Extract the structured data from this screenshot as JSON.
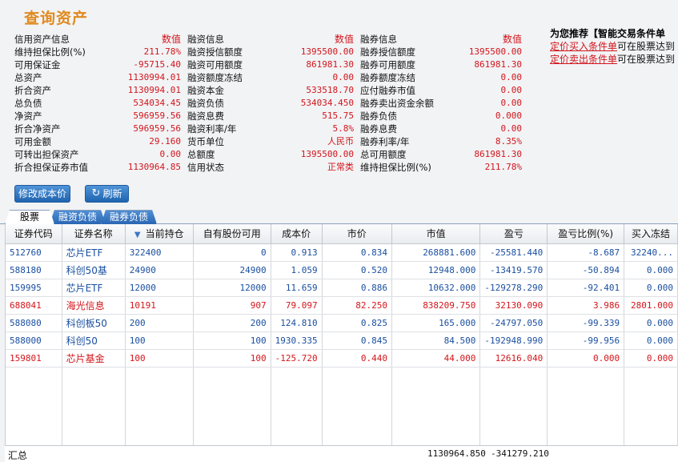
{
  "title": "查询资产",
  "info": {
    "header": [
      {
        "label": "信用资产信息",
        "value": "数值"
      },
      {
        "label": "融资信息",
        "value": "数值"
      },
      {
        "label": "融券信息",
        "value": "数值"
      }
    ],
    "rows": [
      [
        {
          "label": "维持担保比例(%)",
          "value": "211.78%"
        },
        {
          "label": "融资授信额度",
          "value": "1395500.00"
        },
        {
          "label": "融券授信额度",
          "value": "1395500.00"
        }
      ],
      [
        {
          "label": "可用保证金",
          "value": "-95715.40"
        },
        {
          "label": "融资可用额度",
          "value": "861981.30"
        },
        {
          "label": "融券可用额度",
          "value": "861981.30"
        }
      ],
      [
        {
          "label": "总资产",
          "value": "1130994.01"
        },
        {
          "label": "融资额度冻结",
          "value": "0.00"
        },
        {
          "label": "融券额度冻结",
          "value": "0.00"
        }
      ],
      [
        {
          "label": "折合资产",
          "value": "1130994.01"
        },
        {
          "label": "融资本金",
          "value": "533518.70"
        },
        {
          "label": "应付融券市值",
          "value": "0.00"
        }
      ],
      [
        {
          "label": "总负债",
          "value": "534034.45"
        },
        {
          "label": "融资负债",
          "value": "534034.450"
        },
        {
          "label": "融券卖出资金余额",
          "value": "0.00"
        }
      ],
      [
        {
          "label": "净资产",
          "value": "596959.56"
        },
        {
          "label": "融资息费",
          "value": "515.75"
        },
        {
          "label": "融券负债",
          "value": "0.000"
        }
      ],
      [
        {
          "label": "折合净资产",
          "value": "596959.56"
        },
        {
          "label": "融资利率/年",
          "value": "5.8%"
        },
        {
          "label": "融券息费",
          "value": "0.00"
        }
      ],
      [
        {
          "label": "可用金额",
          "value": "29.160"
        },
        {
          "label": "货币单位",
          "value": "人民币"
        },
        {
          "label": "融券利率/年",
          "value": "8.35%"
        }
      ],
      [
        {
          "label": "可转出担保资产",
          "value": "0.00"
        },
        {
          "label": "总额度",
          "value": "1395500.00"
        },
        {
          "label": "总可用额度",
          "value": "861981.30"
        }
      ],
      [
        {
          "label": "折合担保证券市值",
          "value": "1130964.85"
        },
        {
          "label": "信用状态",
          "value": "正常类"
        },
        {
          "label": "维持担保比例(%)",
          "value": "211.78%"
        }
      ]
    ]
  },
  "promo": {
    "title": "为您推荐【智能交易条件单",
    "line1_link": "定价买入条件单",
    "line1_text": "可在股票达到",
    "line2_link": "定价卖出条件单",
    "line2_text": "可在股票达到"
  },
  "buttons": {
    "edit_cost": "修改成本价",
    "refresh": "刷新"
  },
  "tabs": [
    "股票",
    "融资负债",
    "融券负债"
  ],
  "table": {
    "columns": [
      "证券代码",
      "证券名称",
      "当前持仓",
      "自有股份可用",
      "成本价",
      "市价",
      "市值",
      "盈亏",
      "盈亏比例(%)",
      "买入冻结"
    ],
    "rows": [
      {
        "color": "blue",
        "cells": [
          "512760",
          "芯片ETF",
          "322400",
          "0",
          "0.913",
          "0.834",
          "268881.600",
          "-25581.440",
          "-8.687",
          "32240..."
        ]
      },
      {
        "color": "blue",
        "cells": [
          "588180",
          "科创50基",
          "24900",
          "24900",
          "1.059",
          "0.520",
          "12948.000",
          "-13419.570",
          "-50.894",
          "0.000"
        ]
      },
      {
        "color": "blue",
        "cells": [
          "159995",
          "芯片ETF",
          "12000",
          "12000",
          "11.659",
          "0.886",
          "10632.000",
          "-129278.290",
          "-92.401",
          "0.000"
        ]
      },
      {
        "color": "red",
        "cells": [
          "688041",
          "海光信息",
          "10191",
          "907",
          "79.097",
          "82.250",
          "838209.750",
          "32130.090",
          "3.986",
          "2801.000"
        ]
      },
      {
        "color": "blue",
        "cells": [
          "588080",
          "科创板50",
          "200",
          "200",
          "124.810",
          "0.825",
          "165.000",
          "-24797.050",
          "-99.339",
          "0.000"
        ]
      },
      {
        "color": "blue",
        "cells": [
          "588000",
          "科创50",
          "100",
          "100",
          "1930.335",
          "0.845",
          "84.500",
          "-192948.990",
          "-99.956",
          "0.000"
        ]
      },
      {
        "color": "red",
        "cells": [
          "159801",
          "芯片基金",
          "100",
          "100",
          "-125.720",
          "0.440",
          "44.000",
          "12616.040",
          "0.000",
          "0.000"
        ]
      }
    ],
    "totals": {
      "label": "汇总",
      "market_value": "1130964.850",
      "profit_loss": "-341279.210"
    }
  }
}
